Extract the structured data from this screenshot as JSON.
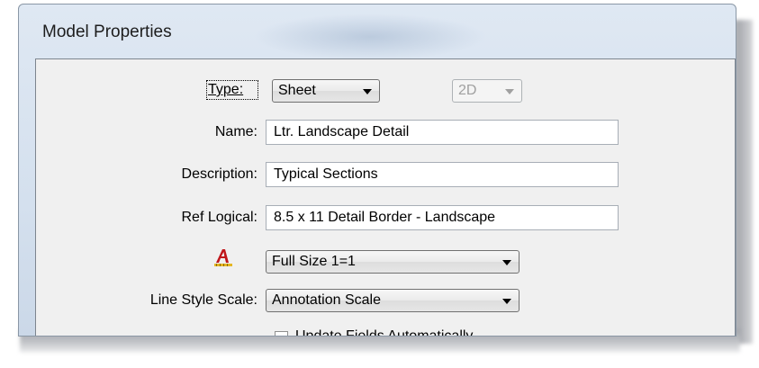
{
  "dialog": {
    "title": "Model Properties"
  },
  "fields": {
    "type": {
      "label": "Type:",
      "value": "Sheet",
      "dimension": "2D"
    },
    "name": {
      "label": "Name:",
      "value": "Ltr. Landscape Detail"
    },
    "description": {
      "label": "Description:",
      "value": "Typical Sections"
    },
    "ref_logical": {
      "label": "Ref Logical:",
      "value": "8.5 x 11 Detail Border - Landscape"
    },
    "annotation_scale": {
      "icon": "annotation-scale-icon",
      "value": "Full Size 1=1"
    },
    "line_style_scale": {
      "label": "Line Style Scale:",
      "value": "Annotation Scale"
    },
    "update_fields": {
      "label": "Update Fields Automatically"
    }
  },
  "colors": {
    "window_bg": "#d4e0ee",
    "client_bg": "#f0f0f0",
    "icon_red": "#c0171b",
    "icon_yellow": "#e5b623"
  }
}
